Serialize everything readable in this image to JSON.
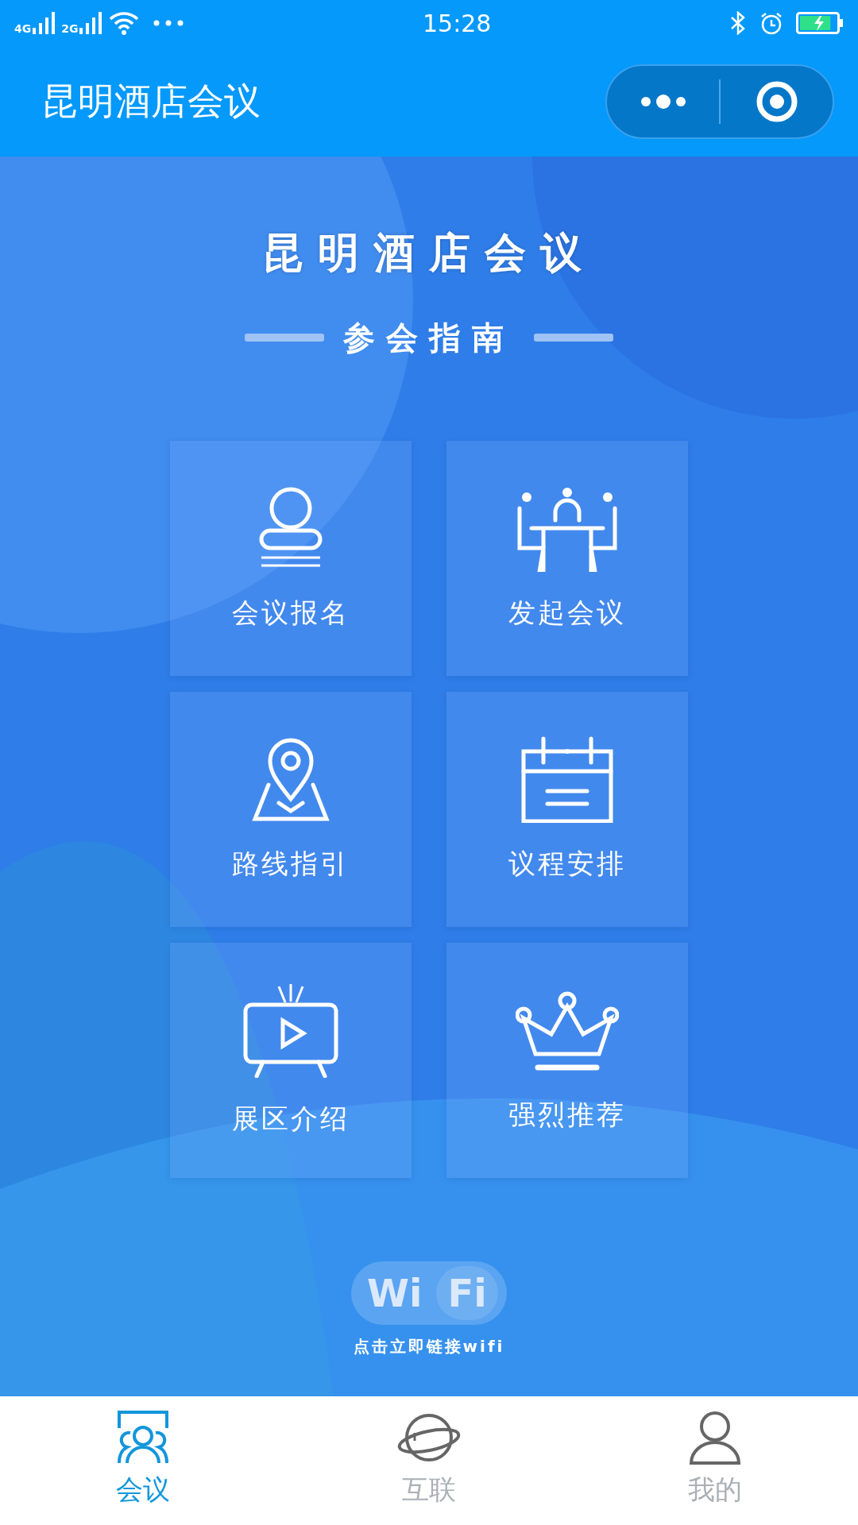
{
  "status_bar": {
    "networks": [
      "4G",
      "2G"
    ],
    "time": "15:28"
  },
  "header": {
    "title": "昆明酒店会议"
  },
  "banner": {
    "title": "昆明酒店会议",
    "subtitle": "参会指南"
  },
  "menu": [
    {
      "label": "会议报名",
      "kind": "register"
    },
    {
      "label": "发起会议",
      "kind": "meeting"
    },
    {
      "label": "路线指引",
      "kind": "route"
    },
    {
      "label": "议程安排",
      "kind": "agenda"
    },
    {
      "label": "展区介绍",
      "kind": "video"
    },
    {
      "label": "强烈推荐",
      "kind": "crown"
    }
  ],
  "wifi": {
    "logo_left": "Wi",
    "logo_right": "Fi",
    "caption": "点击立即链接wifi"
  },
  "tabs": [
    {
      "label": "会议",
      "kind": "meeting",
      "selected": true
    },
    {
      "label": "互联",
      "kind": "planet",
      "selected": false
    },
    {
      "label": "我的",
      "kind": "person",
      "selected": false
    }
  ]
}
